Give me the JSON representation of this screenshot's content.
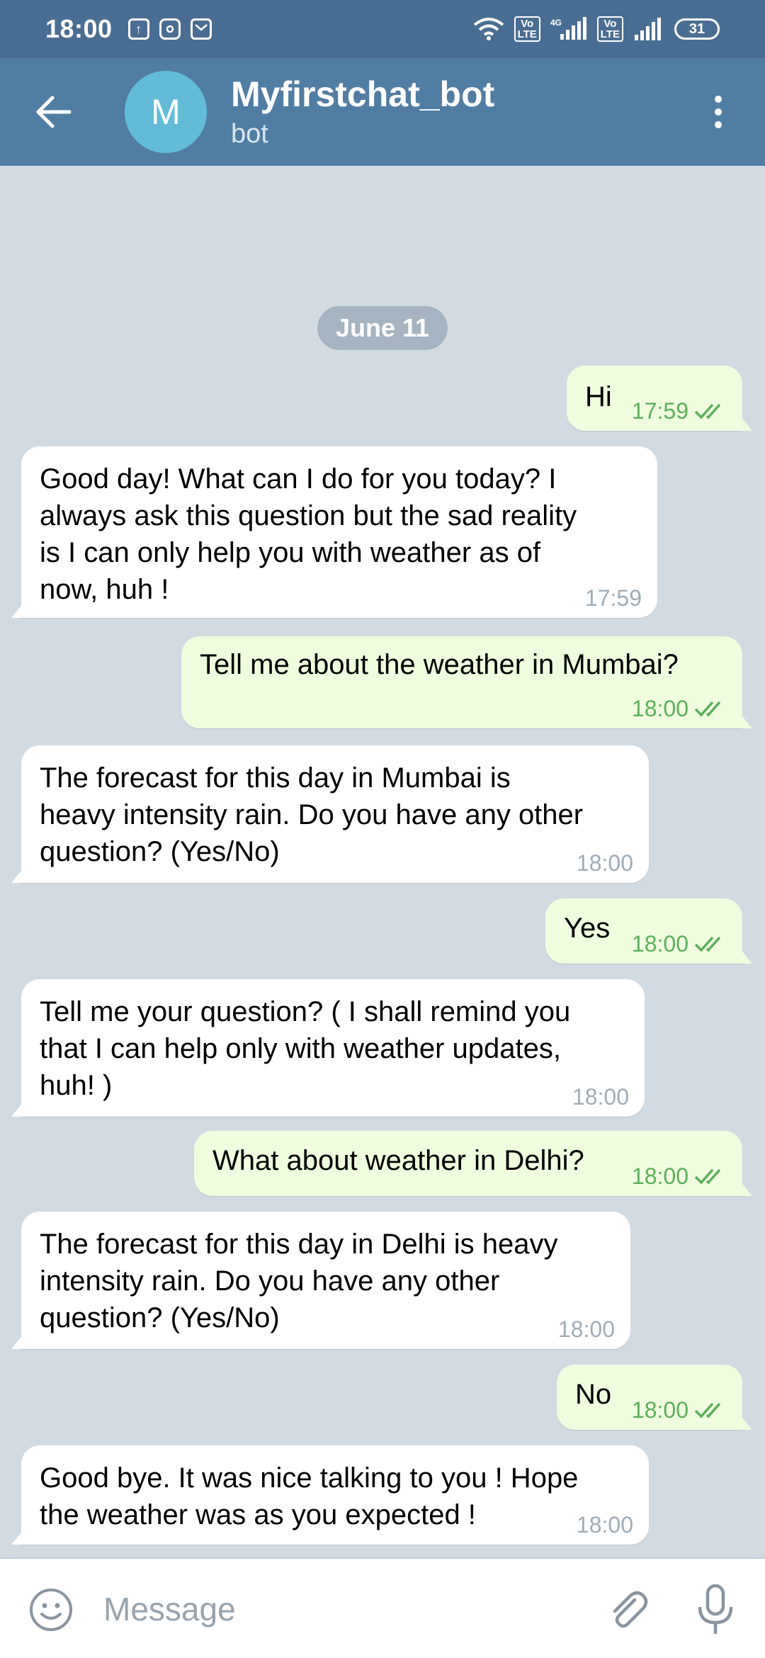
{
  "status_bar": {
    "time": "18:00",
    "battery": "31",
    "network": "4G",
    "lte_tag": "Vo\nLTE"
  },
  "header": {
    "avatar_letter": "M",
    "title": "Myfirstchat_bot",
    "subtitle": "bot"
  },
  "chat": {
    "date_label": "June 11",
    "messages": [
      {
        "direction": "out",
        "text": "Hi",
        "time": "17:59",
        "read": true
      },
      {
        "direction": "in",
        "text": "Good day! What can I do for you today? I\nalways ask this question but the sad reality\nis I can only help you with weather as of\nnow, huh !",
        "time": "17:59"
      },
      {
        "direction": "out",
        "text": "Tell me about the weather in Mumbai?",
        "time": "18:00",
        "read": true
      },
      {
        "direction": "in",
        "text": "The forecast for this day in Mumbai is\nheavy intensity rain. Do you have any other\nquestion? (Yes/No)",
        "time": "18:00"
      },
      {
        "direction": "out",
        "text": "Yes",
        "time": "18:00",
        "read": true
      },
      {
        "direction": "in",
        "text": "Tell me your question? ( I shall remind you\nthat I can help only with weather updates,\nhuh! )",
        "time": "18:00"
      },
      {
        "direction": "out",
        "text": "What about weather in Delhi?",
        "time": "18:00",
        "read": true
      },
      {
        "direction": "in",
        "text": "The forecast for this day in Delhi is heavy\nintensity rain. Do you have any other\nquestion? (Yes/No)",
        "time": "18:00"
      },
      {
        "direction": "out",
        "text": "No",
        "time": "18:00",
        "read": true
      },
      {
        "direction": "in",
        "text": "Good bye. It was nice talking to you ! Hope\nthe weather was as you expected !",
        "time": "18:00"
      }
    ]
  },
  "input": {
    "placeholder": "Message"
  },
  "colors": {
    "header_bg": "#527da3",
    "status_bg": "#4a6e93",
    "outgoing_bubble": "#effdde",
    "incoming_bubble": "#ffffff",
    "read_ticks": "#5cb05a",
    "avatar_bg": "#62bcd8"
  },
  "icons": [
    "back-arrow-icon",
    "more-vert-icon",
    "emoji-icon",
    "attach-icon",
    "mic-icon",
    "wifi-icon",
    "signal-icon",
    "battery-icon"
  ]
}
